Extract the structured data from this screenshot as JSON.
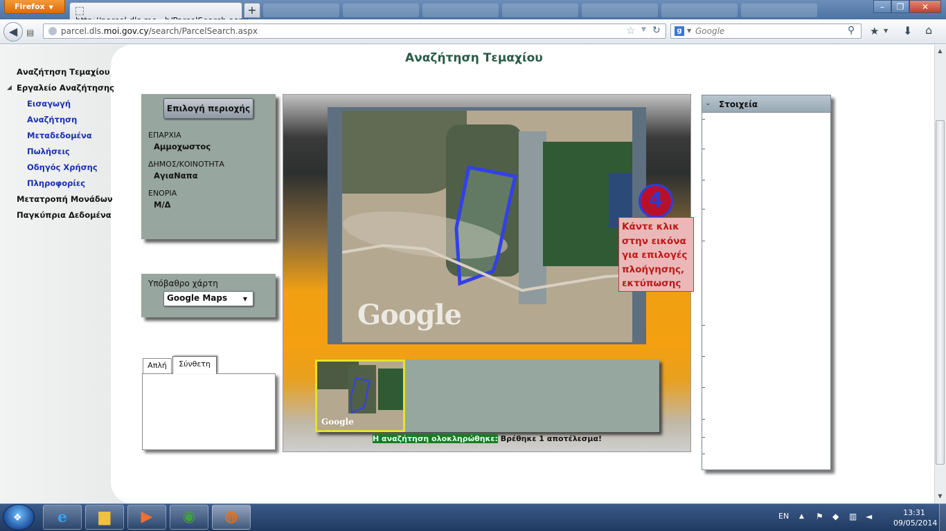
{
  "browser": {
    "app_button": "Firefox",
    "tab_title": "http://parcel.dls.mo...h/ParcelSearch.aspx",
    "new_tab": "+",
    "url_host_prefix": "parcel.dls.",
    "url_host_main": "moi.gov.cy",
    "url_path": "/search/ParcelSearch.aspx",
    "search_placeholder": "Google",
    "window_controls": {
      "minimize": "–",
      "maximize": "❐",
      "close": "✕"
    }
  },
  "sidebar": {
    "items": [
      {
        "label": "Αναζήτηση Τεμαχίου",
        "level": "top"
      },
      {
        "label": "Εργαλείο Αναζήτησης",
        "level": "top",
        "expanded": true
      },
      {
        "label": "Εισαγωγή",
        "level": "sub"
      },
      {
        "label": "Αναζήτηση",
        "level": "sub"
      },
      {
        "label": "Μεταδεδομένα",
        "level": "sub"
      },
      {
        "label": "Πωλήσεις",
        "level": "sub"
      },
      {
        "label": "Οδηγός Χρήσης",
        "level": "sub"
      },
      {
        "label": "Πληροφορίες",
        "level": "sub"
      },
      {
        "label": "Μετατροπή Μονάδων",
        "level": "top"
      },
      {
        "label": "Παγκύπρια Δεδομένα",
        "level": "top"
      }
    ]
  },
  "page": {
    "title": "Αναζήτηση Τεμαχίου"
  },
  "area": {
    "button": "Επιλογή περιοχής",
    "fields": [
      {
        "label": "ΕΠΑΡΧΙΑ",
        "value": "Αμμοχωστος"
      },
      {
        "label": "ΔΗΜΟΣ/ΚΟΙΝΟΤΗΤΑ",
        "value": "ΑγιαΝαπα"
      },
      {
        "label": "ΕΝΟΡΙΑ",
        "value": "Μ/Δ"
      }
    ]
  },
  "basemap": {
    "label": "Υπόβαθρο χάρτη",
    "selected": "Google Maps"
  },
  "search_tabs": {
    "simple": "Απλή",
    "complex": "Σύνθετη"
  },
  "map": {
    "watermark": "Google",
    "thumb_watermark": "Google",
    "step_badge": "4",
    "tooltip": "Κάντε κλικ στην εικόνα για επιλογές πλοήγησης, εκτύπωσης"
  },
  "status": {
    "done_text": "Η αναζήτηση ολοκληρώθηκε:",
    "result_text": " Βρέθηκε 1 αποτέλεσμα!"
  },
  "info_panel": {
    "title": "Στοιχεία"
  },
  "taskbar": {
    "lang": "EN",
    "time": "13:31",
    "date": "09/05/2014"
  },
  "colors": {
    "sidebar_top": "#111111",
    "sidebar_sub": "#1a2fb0",
    "title_green": "#2a5a44",
    "panel_bg": "#97a69e",
    "tooltip_text": "#c01818",
    "parcel_outline": "#3340e8",
    "status_bg": "#157d20"
  }
}
